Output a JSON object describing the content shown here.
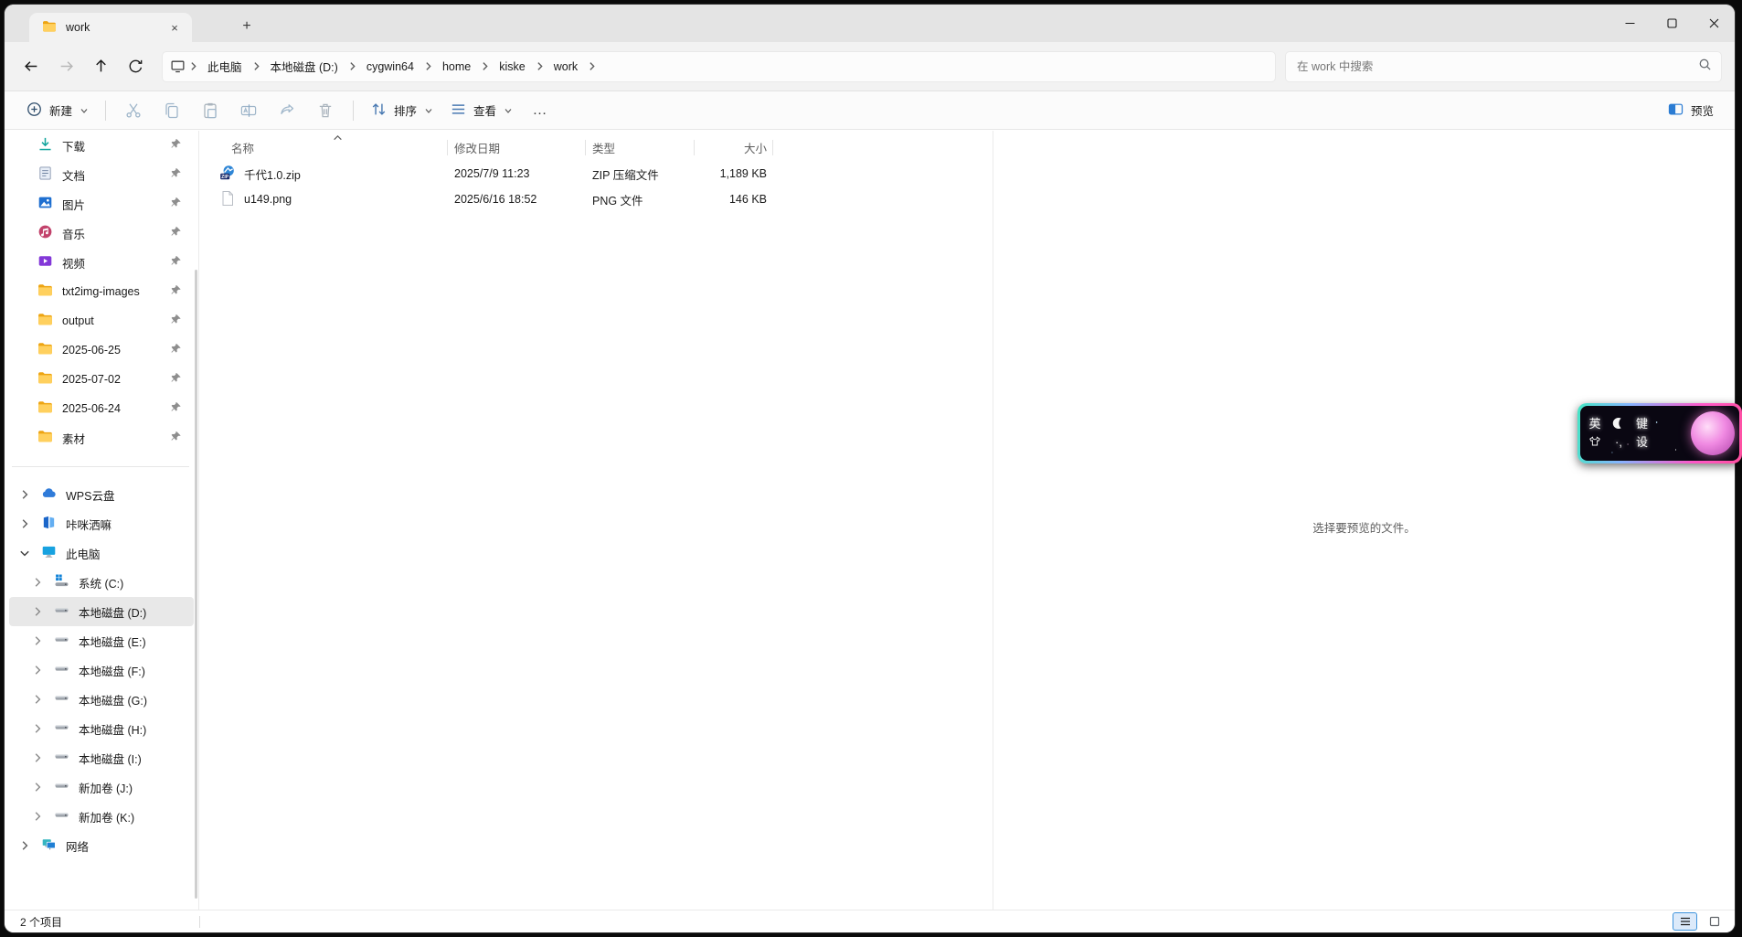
{
  "window": {
    "tab_title": "work"
  },
  "titlebar": {
    "new_tab_glyph": "+",
    "close_tab_glyph": "×"
  },
  "breadcrumb": {
    "segments": [
      "此电脑",
      "本地磁盘 (D:)",
      "cygwin64",
      "home",
      "kiske",
      "work"
    ]
  },
  "nav": {
    "search_placeholder": "在 work 中搜索"
  },
  "toolbar": {
    "new_label": "新建",
    "sort_label": "排序",
    "view_label": "查看",
    "more_glyph": "…",
    "preview_label": "预览"
  },
  "sidebar": {
    "pinned": [
      {
        "label": "下载"
      },
      {
        "label": "文档"
      },
      {
        "label": "图片"
      },
      {
        "label": "音乐"
      },
      {
        "label": "视频"
      },
      {
        "label": "txt2img-images"
      },
      {
        "label": "output"
      },
      {
        "label": "2025-06-25"
      },
      {
        "label": "2025-07-02"
      },
      {
        "label": "2025-06-24"
      },
      {
        "label": "素材"
      }
    ],
    "tree": [
      {
        "label": "WPS云盘"
      },
      {
        "label": "咔咪洒嘛"
      },
      {
        "label": "此电脑"
      },
      {
        "label": "系统 (C:)"
      },
      {
        "label": "本地磁盘 (D:)"
      },
      {
        "label": "本地磁盘 (E:)"
      },
      {
        "label": "本地磁盘 (F:)"
      },
      {
        "label": "本地磁盘 (G:)"
      },
      {
        "label": "本地磁盘 (H:)"
      },
      {
        "label": "本地磁盘 (I:)"
      },
      {
        "label": "新加卷 (J:)"
      },
      {
        "label": "新加卷 (K:)"
      },
      {
        "label": "网络"
      }
    ]
  },
  "files": {
    "columns": [
      "名称",
      "修改日期",
      "类型",
      "大小"
    ],
    "rows": [
      {
        "name": "千代1.0.zip",
        "date": "2025/7/9 11:23",
        "type": "ZIP 压缩文件",
        "size": "1,189 KB"
      },
      {
        "name": "u149.png",
        "date": "2025/6/16 18:52",
        "type": "PNG 文件",
        "size": "146 KB"
      }
    ]
  },
  "preview_pane": {
    "empty_message": "选择要预览的文件。"
  },
  "status_bar": {
    "items_count": "2 个项目"
  },
  "ime": {
    "lang_toggle": "英",
    "keyboard_key": "键",
    "settings_key": "设",
    "punctuation": "·,"
  },
  "colors": {
    "accent_blue": "#2b7cd3",
    "folder_yellow": "#ffb900",
    "selection_gray": "#e8e8e8",
    "ime_pink": "#ff57c8",
    "ime_teal": "#45e6c4"
  }
}
